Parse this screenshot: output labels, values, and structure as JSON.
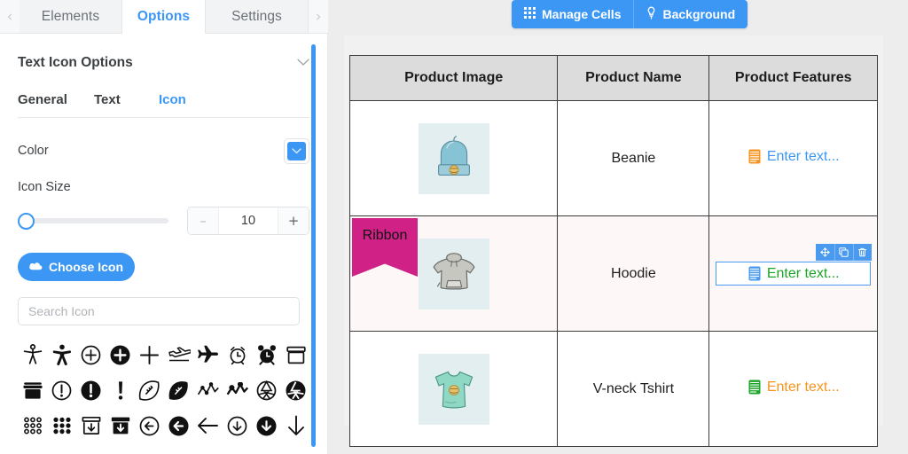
{
  "left_panel": {
    "tabs": {
      "prev_arrow": "‹",
      "next_arrow": "›",
      "items": [
        {
          "label": "Elements",
          "active": false
        },
        {
          "label": "Options",
          "active": true
        },
        {
          "label": "Settings",
          "active": false
        }
      ]
    },
    "section": {
      "title": "Text Icon Options",
      "collapse_icon": "chevron-down-icon"
    },
    "subtabs": [
      {
        "label": "General",
        "active": false
      },
      {
        "label": "Text",
        "active": false
      },
      {
        "label": "Icon",
        "active": true
      }
    ],
    "color": {
      "label": "Color",
      "swatch_hex": "#3b97f3",
      "chevron": "⌄"
    },
    "icon_size": {
      "label": "Icon Size",
      "value": "10",
      "minus": "–",
      "plus": "+",
      "slider_percent": 0
    },
    "choose_icon_button": {
      "label": "Choose Icon",
      "icon": "cloud-icon",
      "bg_hex": "#3b97f3"
    },
    "search": {
      "placeholder": "Search Icon",
      "value": ""
    },
    "icon_grid": [
      "accessible-icon",
      "universal-access-icon",
      "plus-circle-outline-icon",
      "plus-circle-solid-icon",
      "plus-icon",
      "plane-departure-icon",
      "plane-solid-icon",
      "alarm-clock-outline-icon",
      "alarm-clock-solid-icon",
      "archive-outline-icon",
      "archive-solid-icon",
      "exclamation-circle-outline-icon",
      "exclamation-circle-solid-icon",
      "exclamation-icon",
      "football-outline-icon",
      "football-solid-icon",
      "chart-line-outline-icon",
      "chart-line-solid-icon",
      "aperture-outline-icon",
      "aperture-solid-icon",
      "dots-grid-outline-icon",
      "dots-grid-solid-icon",
      "box-arrow-down-outline-icon",
      "box-arrow-down-solid-icon",
      "arrow-circle-left-outline-icon",
      "arrow-circle-left-solid-icon",
      "arrow-left-icon",
      "arrow-circle-down-outline-icon",
      "arrow-circle-down-solid-icon",
      "arrow-down-icon"
    ],
    "scrollbar_hex": "#3b97f3"
  },
  "toolbar": {
    "manage_cells": {
      "label": "Manage Cells",
      "icon": "grid-icon"
    },
    "background": {
      "label": "Background",
      "icon": "pin-icon"
    },
    "bg_hex": "#3b97f3"
  },
  "table": {
    "headers": [
      "Product Image",
      "Product Name",
      "Product Features"
    ],
    "rows": [
      {
        "image_alt": "beanie-thumbnail",
        "name": "Beanie",
        "feature_placeholder": "Enter text...",
        "feature_text_hex": "#3b97f3",
        "feature_icon_hex": "#f7941d",
        "feature_icon": "text-lines-icon",
        "ribbon": null,
        "selected": false,
        "highlight": false
      },
      {
        "image_alt": "hoodie-thumbnail",
        "name": "Hoodie",
        "feature_placeholder": "Enter text...",
        "feature_text_hex": "#1aa526",
        "feature_icon_hex": "#4a9bf0",
        "feature_icon": "text-lines-icon",
        "ribbon": {
          "label": "Ribbon",
          "bg_hex": "#cf2186"
        },
        "selected": true,
        "highlight": true
      },
      {
        "image_alt": "v-neck-tshirt-thumbnail",
        "name": "V-neck Tshirt",
        "feature_placeholder": "Enter text...",
        "feature_text_hex": "#f7941d",
        "feature_icon_hex": "#1aa526",
        "feature_icon": "text-lines-icon",
        "ribbon": null,
        "selected": false,
        "highlight": false
      }
    ]
  },
  "cell_tools": [
    {
      "name": "move-icon",
      "title": "move"
    },
    {
      "name": "duplicate-icon",
      "title": "duplicate"
    },
    {
      "name": "delete-icon",
      "title": "delete"
    }
  ]
}
